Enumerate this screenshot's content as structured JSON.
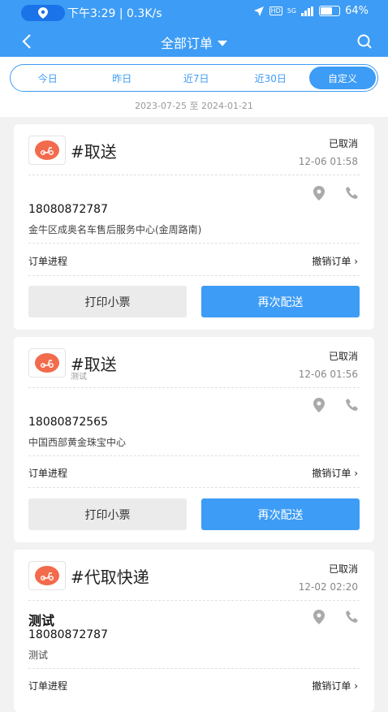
{
  "status_bar": {
    "time": "下午3:29 | 0.3K/s",
    "hd_label": "HD",
    "signal_label": "5G",
    "battery": "64%",
    "battery_level": 0.64
  },
  "nav": {
    "title": "全部订单"
  },
  "filter": {
    "tabs": [
      {
        "label": "今日"
      },
      {
        "label": "昨日"
      },
      {
        "label": "近7日"
      },
      {
        "label": "近30日"
      },
      {
        "label": "自定义",
        "active": true
      }
    ],
    "date_range": "2023-07-25 至 2024-01-21"
  },
  "orders": [
    {
      "service": "#取送",
      "sub": "",
      "status": "已取消",
      "time": "12-06 01:58",
      "name": "",
      "phone": "18080872787",
      "address": "金牛区成奥名车售后服务中心(金周路南)",
      "progress_label": "订单进程",
      "cancel_label": "撤销订单",
      "print_label": "打印小票",
      "again_label": "再次配送"
    },
    {
      "service": "#取送",
      "sub": "测试",
      "status": "已取消",
      "time": "12-06 01:56",
      "name": "",
      "phone": "18080872565",
      "address": "中国西部黄金珠宝中心",
      "progress_label": "订单进程",
      "cancel_label": "撤销订单",
      "print_label": "打印小票",
      "again_label": "再次配送"
    },
    {
      "service": "#代取快递",
      "sub": "",
      "status": "已取消",
      "time": "12-02 02:20",
      "name": "测试",
      "phone": "18080872787",
      "address": "测试",
      "progress_label": "订单进程",
      "cancel_label": "撤销订单"
    }
  ],
  "colors": {
    "primary": "#3d9cf5",
    "logo_red": "#f26b4c"
  }
}
